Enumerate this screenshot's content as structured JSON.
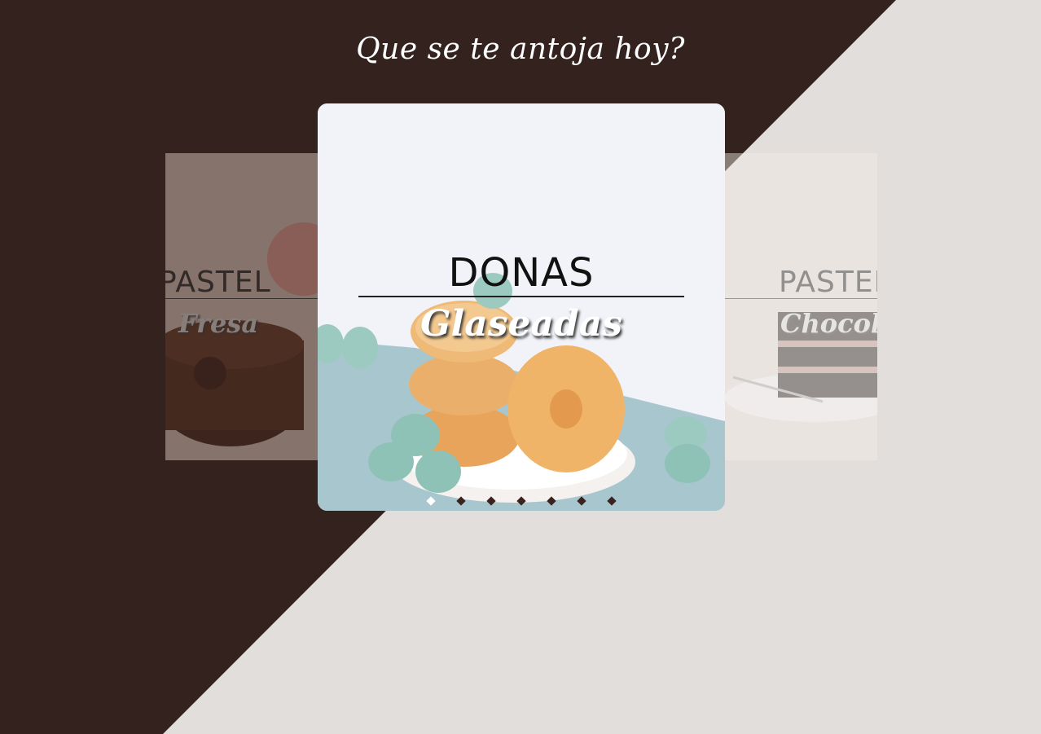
{
  "colors": {
    "dark_bg": "#33221e",
    "light_bg": "#e2dedb",
    "dot_active": "#ffffff",
    "dot_inactive": "#3a231e"
  },
  "heading": "Que se te antoja hoy?",
  "carousel": {
    "left": {
      "title": "PASTEL",
      "subtitle": "Fresa"
    },
    "center": {
      "title": "DONAS",
      "subtitle": "Glaseadas"
    },
    "right": {
      "title": "PASTEL",
      "subtitle": "Chocolate"
    },
    "active_index": 0,
    "total_slides": 7
  }
}
